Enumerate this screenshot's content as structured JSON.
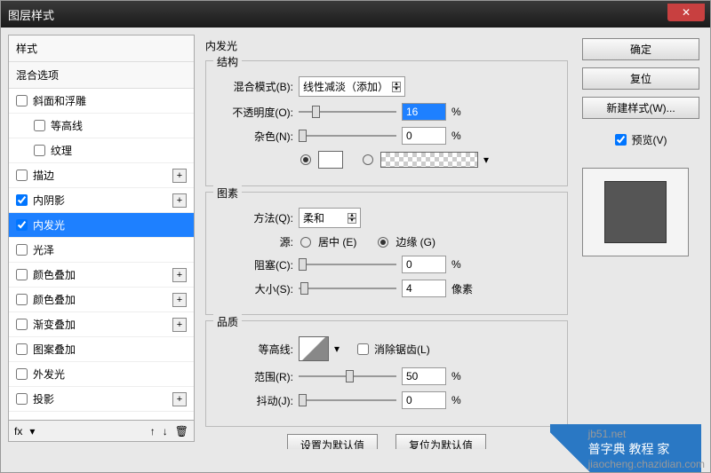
{
  "window": {
    "title": "图层样式"
  },
  "left": {
    "styles_label": "样式",
    "blend_label": "混合选项",
    "items": [
      {
        "label": "斜面和浮雕",
        "checked": false,
        "indent": false,
        "plus": false
      },
      {
        "label": "等高线",
        "checked": false,
        "indent": true,
        "plus": false
      },
      {
        "label": "纹理",
        "checked": false,
        "indent": true,
        "plus": false
      },
      {
        "label": "描边",
        "checked": false,
        "indent": false,
        "plus": true
      },
      {
        "label": "内阴影",
        "checked": true,
        "indent": false,
        "plus": true
      },
      {
        "label": "内发光",
        "checked": true,
        "indent": false,
        "plus": false,
        "selected": true
      },
      {
        "label": "光泽",
        "checked": false,
        "indent": false,
        "plus": false
      },
      {
        "label": "颜色叠加",
        "checked": false,
        "indent": false,
        "plus": true
      },
      {
        "label": "颜色叠加",
        "checked": false,
        "indent": false,
        "plus": true
      },
      {
        "label": "渐变叠加",
        "checked": false,
        "indent": false,
        "plus": true
      },
      {
        "label": "图案叠加",
        "checked": false,
        "indent": false,
        "plus": false
      },
      {
        "label": "外发光",
        "checked": false,
        "indent": false,
        "plus": false
      },
      {
        "label": "投影",
        "checked": false,
        "indent": false,
        "plus": true
      }
    ],
    "fx_label": "fx"
  },
  "panel": {
    "title": "内发光",
    "structure": {
      "group_title": "结构",
      "blend_mode_label": "混合模式(B):",
      "blend_mode_value": "线性减淡（添加）",
      "opacity_label": "不透明度(O):",
      "opacity_value": "16",
      "opacity_unit": "%",
      "noise_label": "杂色(N):",
      "noise_value": "0",
      "noise_unit": "%",
      "color_swatch": "#ffffff"
    },
    "elements": {
      "group_title": "图素",
      "technique_label": "方法(Q):",
      "technique_value": "柔和",
      "source_label": "源:",
      "source_center": "居中 (E)",
      "source_edge": "边缘 (G)",
      "choke_label": "阻塞(C):",
      "choke_value": "0",
      "choke_unit": "%",
      "size_label": "大小(S):",
      "size_value": "4",
      "size_unit": "像素"
    },
    "quality": {
      "group_title": "品质",
      "contour_label": "等高线:",
      "antialias_label": "消除锯齿(L)",
      "range_label": "范围(R):",
      "range_value": "50",
      "range_unit": "%",
      "jitter_label": "抖动(J):",
      "jitter_value": "0",
      "jitter_unit": "%"
    },
    "defaults": {
      "set_default": "设置为默认值",
      "reset_default": "复位为默认值"
    }
  },
  "right": {
    "ok": "确定",
    "reset": "复位",
    "new_style": "新建样式(W)...",
    "preview": "预览(V)"
  },
  "watermark": {
    "line1": "jb51.net",
    "line2": "普字典   教程  家",
    "line3": "jiaocheng.chazidian.com"
  }
}
